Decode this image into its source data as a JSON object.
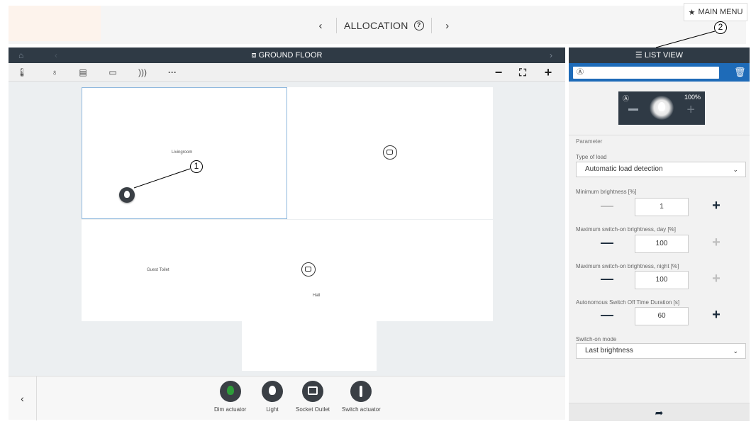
{
  "header": {
    "nav_prev_icon": "chevron-left",
    "title": "ALLOCATION",
    "help_icon": "question-icon",
    "nav_next_icon": "chevron-right",
    "main_menu_label": "MAIN MENU",
    "main_menu_icon": "star-icon"
  },
  "floor": {
    "title": "GROUND FLOOR",
    "toolbar_more": "···",
    "zoom_out": "−",
    "zoom_in": "+"
  },
  "rooms": {
    "livingroom": "Livingroom",
    "guest_toilet": "Guest Toilet",
    "hall": "Hall"
  },
  "palette": {
    "items": [
      {
        "label": "Dim actuator",
        "icon": "dim-actuator-icon",
        "color": "#2e9d3a"
      },
      {
        "label": "Light",
        "icon": "light-icon",
        "color": "#3a3f45"
      },
      {
        "label": "Socket Outlet",
        "icon": "socket-outlet-icon",
        "color": "#3a3f45"
      },
      {
        "label": "Switch actuator",
        "icon": "switch-actuator-icon",
        "color": "#3a3f45"
      }
    ]
  },
  "right_panel": {
    "title": "LIST VIEW",
    "search_value": "Ⓐ",
    "dimmer": {
      "mode": "Ⓐ",
      "percent": "100%"
    },
    "parameter_title": "Parameter",
    "type_of_load_label": "Type of load",
    "type_of_load_value": "Automatic load detection",
    "min_brightness_label": "Minimum brightness [%]",
    "min_brightness_value": "1",
    "max_day_label": "Maximum switch-on brightness, day [%]",
    "max_day_value": "100",
    "max_night_label": "Maximum switch-on brightness, night [%]",
    "max_night_value": "100",
    "auto_off_label": "Autonomous Switch Off Time Duration [s]",
    "auto_off_value": "60",
    "switch_on_mode_label": "Switch-on mode",
    "switch_on_mode_value": "Last brightness"
  },
  "callouts": {
    "one": "1",
    "two": "2"
  },
  "colors": {
    "dark_header": "#2f3a45",
    "accent_blue": "#1e6bb8"
  }
}
